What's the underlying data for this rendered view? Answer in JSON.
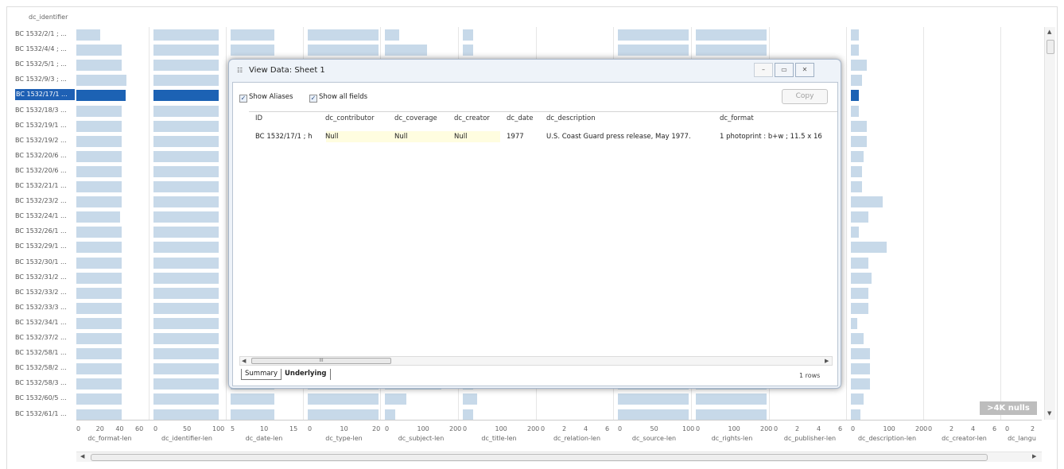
{
  "view": {
    "row_header_title": "dc_identifier",
    "nulls_badge": ">4K nulls"
  },
  "rows": [
    {
      "label": "BC 1532/2/1 ; ..."
    },
    {
      "label": "BC 1532/4/4 ; ..."
    },
    {
      "label": "BC 1532/5/1 ; ..."
    },
    {
      "label": "BC 1532/9/3 ; ..."
    },
    {
      "label": "BC 1532/17/1 ...",
      "selected": true
    },
    {
      "label": "BC 1532/18/3 ..."
    },
    {
      "label": "BC 1532/19/1 ..."
    },
    {
      "label": "BC 1532/19/2 ..."
    },
    {
      "label": "BC 1532/20/6 ..."
    },
    {
      "label": "BC 1532/20/6 ..."
    },
    {
      "label": "BC 1532/21/1 ..."
    },
    {
      "label": "BC 1532/23/2 ..."
    },
    {
      "label": "BC 1532/24/1 ..."
    },
    {
      "label": "BC 1532/26/1 ..."
    },
    {
      "label": "BC 1532/29/1 ..."
    },
    {
      "label": "BC 1532/30/1 ..."
    },
    {
      "label": "BC 1532/31/2 ..."
    },
    {
      "label": "BC 1532/33/2 ..."
    },
    {
      "label": "BC 1532/33/3 ..."
    },
    {
      "label": "BC 1532/34/1 ..."
    },
    {
      "label": "BC 1532/37/2 ..."
    },
    {
      "label": "BC 1532/58/1 ..."
    },
    {
      "label": "BC 1532/58/2 ..."
    },
    {
      "label": "BC 1532/58/3 ..."
    },
    {
      "label": "BC 1532/60/5 ..."
    },
    {
      "label": "BC 1532/61/1 ..."
    }
  ],
  "columns": [
    {
      "title": "dc_format-len",
      "ticks": [
        "0",
        "20",
        "40",
        "60"
      ],
      "max": 60,
      "values": [
        22,
        42,
        42,
        46,
        45,
        42,
        42,
        42,
        42,
        42,
        42,
        42,
        40,
        42,
        42,
        42,
        42,
        42,
        42,
        42,
        42,
        42,
        42,
        42,
        42,
        42
      ]
    },
    {
      "title": "dc_identifier-len",
      "ticks": [
        "0",
        "50",
        "100"
      ],
      "max": 100,
      "values": [
        100,
        100,
        100,
        100,
        100,
        100,
        100,
        100,
        100,
        100,
        100,
        100,
        100,
        100,
        100,
        100,
        100,
        100,
        100,
        100,
        100,
        100,
        100,
        100,
        100,
        100
      ]
    },
    {
      "title": "dc_date-len",
      "ticks": [
        "5",
        "10",
        "15"
      ],
      "max": 15,
      "values": [
        10,
        10,
        10,
        10,
        10,
        10,
        10,
        10,
        10,
        10,
        10,
        10,
        10,
        10,
        10,
        10,
        10,
        10,
        10,
        10,
        10,
        10,
        10,
        10,
        10,
        10
      ]
    },
    {
      "title": "dc_type-len",
      "ticks": [
        "0",
        "10",
        "20"
      ],
      "max": 20,
      "values": [
        20,
        20,
        20,
        20,
        20,
        20,
        20,
        20,
        20,
        20,
        20,
        20,
        20,
        20,
        20,
        20,
        20,
        20,
        20,
        20,
        20,
        20,
        20,
        20,
        20,
        20
      ]
    },
    {
      "title": "dc_subject-len",
      "ticks": [
        "0",
        "100",
        "200"
      ],
      "max": 200,
      "values": [
        40,
        120,
        130,
        110,
        90,
        100,
        100,
        100,
        100,
        100,
        100,
        100,
        100,
        100,
        100,
        100,
        100,
        100,
        100,
        100,
        100,
        100,
        100,
        160,
        60,
        30
      ]
    },
    {
      "title": "dc_title-len",
      "ticks": [
        "0",
        "100",
        "200"
      ],
      "max": 200,
      "values": [
        30,
        30,
        50,
        30,
        30,
        30,
        30,
        30,
        30,
        30,
        30,
        30,
        30,
        30,
        30,
        30,
        30,
        30,
        30,
        30,
        30,
        30,
        30,
        30,
        40,
        30
      ]
    },
    {
      "title": "dc_relation-len",
      "ticks": [
        "0",
        "2",
        "4",
        "6"
      ],
      "max": 7,
      "values": [
        0,
        0,
        0,
        0,
        0,
        0,
        0,
        0,
        0,
        0,
        0,
        0,
        0,
        0,
        0,
        0,
        0,
        0,
        0,
        0,
        0,
        0,
        0,
        0,
        0,
        0
      ]
    },
    {
      "title": "dc_source-len",
      "ticks": [
        "0",
        "50",
        "100"
      ],
      "max": 100,
      "values": [
        100,
        100,
        100,
        100,
        100,
        100,
        100,
        100,
        100,
        100,
        100,
        100,
        100,
        100,
        100,
        100,
        100,
        100,
        100,
        100,
        100,
        100,
        100,
        100,
        100,
        100
      ]
    },
    {
      "title": "dc_rights-len",
      "ticks": [
        "0",
        "100",
        "200"
      ],
      "max": 200,
      "values": [
        200,
        200,
        200,
        200,
        200,
        200,
        200,
        200,
        200,
        200,
        200,
        200,
        200,
        200,
        200,
        200,
        200,
        200,
        200,
        200,
        200,
        200,
        200,
        200,
        200,
        200
      ]
    },
    {
      "title": "dc_publisher-len",
      "ticks": [
        "0",
        "2",
        "4",
        "6"
      ],
      "max": 7,
      "values": [
        0,
        0,
        0,
        0,
        0,
        0,
        0,
        0,
        0,
        0,
        0,
        0,
        0,
        0,
        0,
        0,
        0,
        0,
        0,
        0,
        0,
        0,
        0,
        0,
        0,
        0
      ]
    },
    {
      "title": "dc_description-len",
      "ticks": [
        "0",
        "100",
        "200"
      ],
      "max": 220,
      "values": [
        25,
        25,
        50,
        35,
        25,
        25,
        50,
        50,
        40,
        35,
        35,
        100,
        55,
        25,
        110,
        55,
        65,
        55,
        55,
        20,
        40,
        60,
        60,
        60,
        40,
        30
      ]
    },
    {
      "title": "dc_creator-len",
      "ticks": [
        "0",
        "2",
        "4",
        "6"
      ],
      "max": 7,
      "values": [
        0,
        0,
        0,
        0,
        0,
        0,
        0,
        0,
        0,
        0,
        0,
        0,
        0,
        0,
        0,
        0,
        0,
        0,
        0,
        0,
        0,
        0,
        0,
        0,
        0,
        0
      ]
    },
    {
      "title": "dc_langu",
      "ticks": [
        "0",
        "2"
      ],
      "max": 4,
      "values": [
        0,
        0,
        0,
        0,
        0,
        0,
        0,
        0,
        0,
        0,
        0,
        0,
        0,
        0,
        0,
        0,
        0,
        0,
        0,
        0,
        0,
        0,
        0,
        0,
        0,
        0
      ]
    }
  ],
  "dialog": {
    "title": "View Data: Sheet 1",
    "show_aliases": "Show Aliases",
    "show_all_fields": "Show all fields",
    "copy": "Copy",
    "headers": [
      "ID",
      "dc_contributor",
      "dc_coverage",
      "dc_creator",
      "dc_date",
      "dc_description",
      "dc_format"
    ],
    "row": [
      "BC 1532/17/1 ; h",
      "Null",
      "Null",
      "Null",
      "1977",
      "U.S. Coast Guard press release, May 1977.",
      "1 photoprint : b+w ; 11.5 x 16"
    ],
    "tabs": [
      "Summary",
      "Underlying"
    ],
    "row_count": "1 rows",
    "scroll_grip": "III"
  }
}
